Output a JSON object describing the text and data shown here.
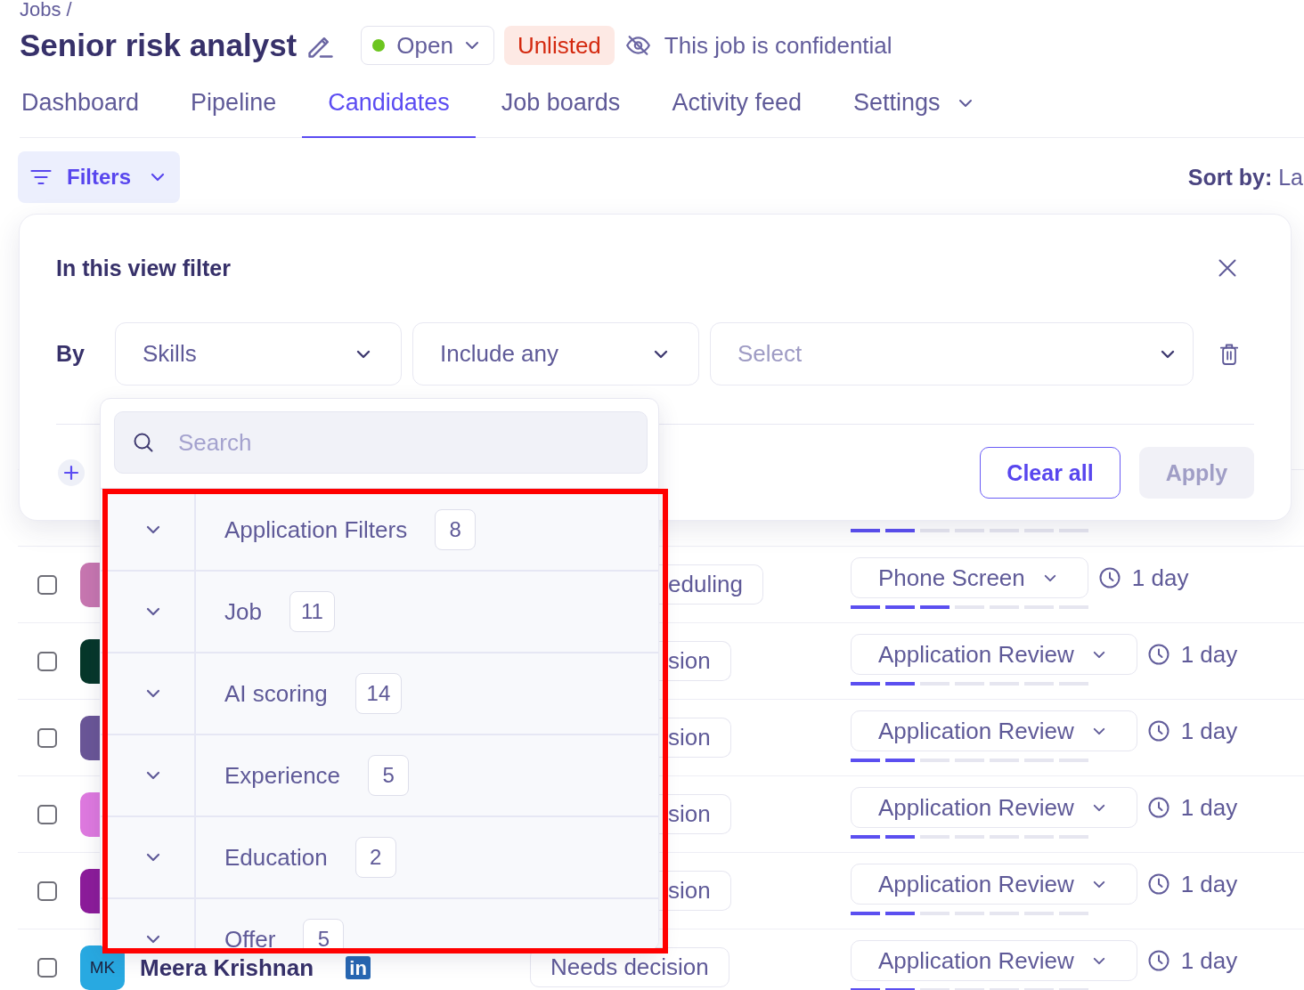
{
  "breadcrumb": "Jobs /",
  "job": {
    "title": "Senior risk analyst",
    "status": "Open",
    "visibility_badge": "Unlisted",
    "confidential_note": "This job is confidential"
  },
  "tabs": [
    {
      "label": "Dashboard",
      "selected": false
    },
    {
      "label": "Pipeline",
      "selected": false
    },
    {
      "label": "Candidates",
      "selected": true
    },
    {
      "label": "Job boards",
      "selected": false
    },
    {
      "label": "Activity feed",
      "selected": false
    },
    {
      "label": "Settings",
      "selected": false,
      "menu": true
    }
  ],
  "toolbar": {
    "filters_button": "Filters",
    "sort": "**Sort by:** La"
  },
  "filter_panel": {
    "title": "In this view filter",
    "by_label": "By",
    "conditions": [
      {
        "field": "Skills",
        "operator": "Include any",
        "value_placeholder": "Select"
      }
    ],
    "buttons": [
      {
        "label": "Clear all",
        "kind": "outline",
        "disabled": false
      },
      {
        "label": "Apply",
        "kind": "primary",
        "disabled": true
      }
    ]
  },
  "field_menu": {
    "search_placeholder": "Search",
    "highlighted": true,
    "groups": [
      {
        "label": "Application Filters",
        "count": "8",
        "expanded": false
      },
      {
        "label": "Job",
        "count": "11",
        "expanded": false
      },
      {
        "label": "AI scoring",
        "count": "14",
        "expanded": false
      },
      {
        "label": "Experience",
        "count": "5",
        "expanded": false
      },
      {
        "label": "Education",
        "count": "2",
        "expanded": false
      },
      {
        "label": "Offer",
        "count": "5",
        "expanded": false
      }
    ]
  },
  "candidates": [
    {
      "kind": "covered",
      "level": 0.2857
    },
    {
      "kind": "covered",
      "checked": false,
      "color": "#c776b0",
      "status": "eduling",
      "stage": "Phone Screen",
      "level": 0.4286,
      "age": "1 day"
    },
    {
      "kind": "covered",
      "checked": false,
      "color": "#06372a",
      "status": "sion",
      "stage": "Application Review",
      "level": 0.2857,
      "age": "1 day"
    },
    {
      "kind": "covered",
      "checked": false,
      "color": "#6a5697",
      "status": "sion",
      "stage": "Application Review",
      "level": 0.2857,
      "age": "1 day"
    },
    {
      "kind": "covered",
      "checked": false,
      "color": "#de79df",
      "status": "sion",
      "stage": "Application Review",
      "level": 0.2857,
      "age": "1 day"
    },
    {
      "kind": "covered",
      "checked": false,
      "color": "#8c1c9a",
      "status": "sion",
      "stage": "Application Review",
      "level": 0.2857,
      "age": "1 day"
    },
    {
      "kind": "full",
      "checked": false,
      "color": "#28a9e1",
      "initials": "MK",
      "name": "Meera Krishnan",
      "profile_badge": "in",
      "status": "Needs decision",
      "stage": "Application Review",
      "level": 0.2857,
      "age": "1 day"
    }
  ]
}
